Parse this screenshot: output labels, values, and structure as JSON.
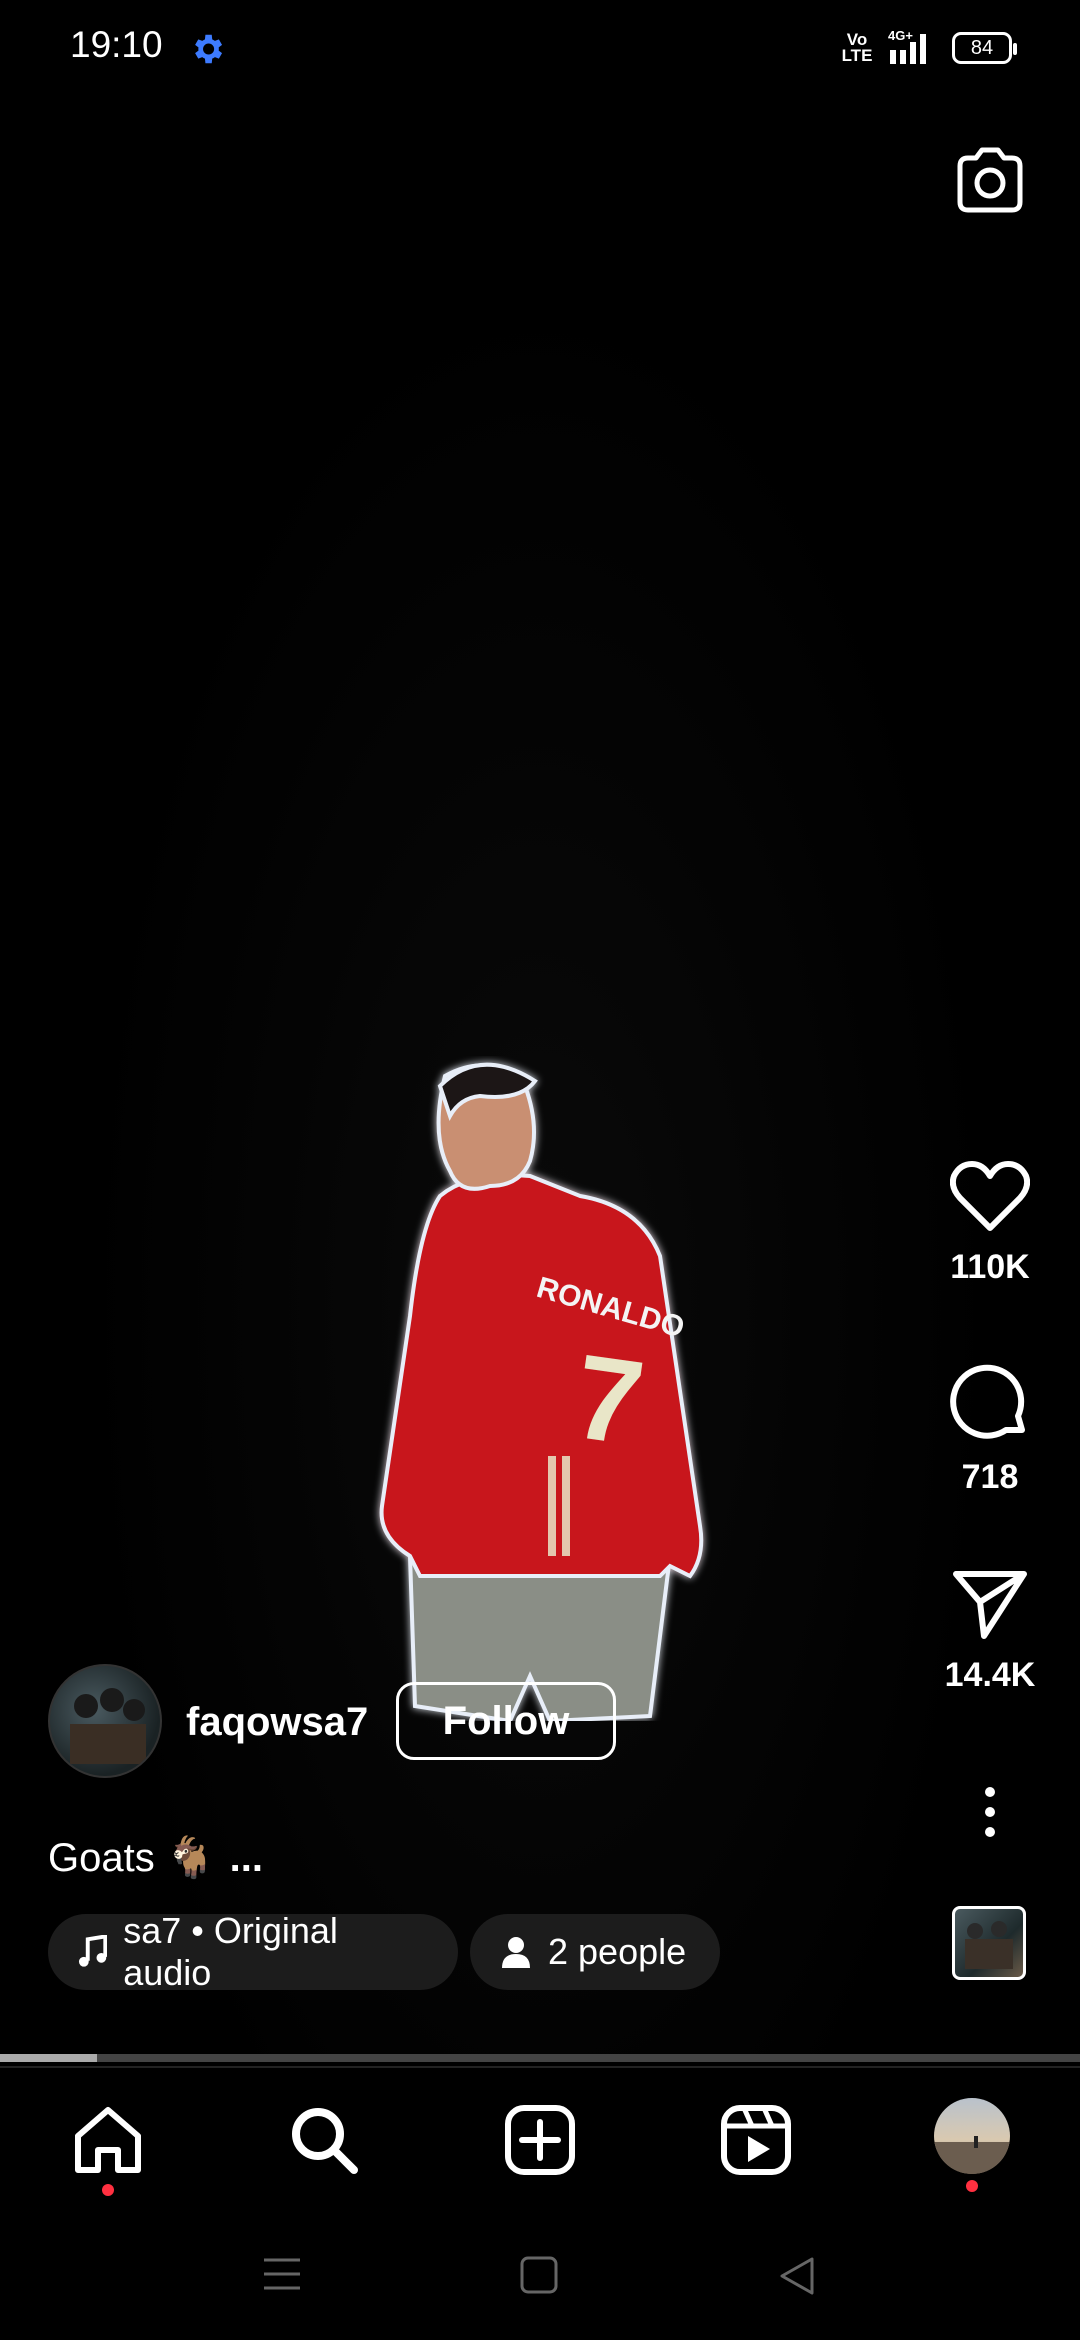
{
  "status_bar": {
    "time": "19:10",
    "network_label": "Vo LTE",
    "network_type": "4G+",
    "battery": "84"
  },
  "post": {
    "username": "faqowsa7",
    "follow_label": "Follow",
    "caption": "Goats 🐐",
    "caption_more": "...",
    "audio_label": "sa7 • Original audio",
    "people_label": "2 people",
    "progress": 0.09
  },
  "actions": {
    "likes": "110K",
    "comments": "718",
    "shares": "14.4K"
  },
  "jersey": {
    "name": "RONALDO",
    "number": "7"
  },
  "colors": {
    "background": "#000000",
    "accent_gear": "#3d7bff",
    "notification_dot": "#ff3040",
    "jersey_red": "#c8141e"
  },
  "icons": {
    "camera": "camera-icon",
    "like": "heart-icon",
    "comment": "comment-bubble-icon",
    "share": "paper-plane-icon",
    "more": "vertical-ellipsis-icon",
    "home": "home-icon",
    "search": "search-icon",
    "create": "plus-square-icon",
    "reels": "reels-icon",
    "profile": "profile-avatar"
  }
}
